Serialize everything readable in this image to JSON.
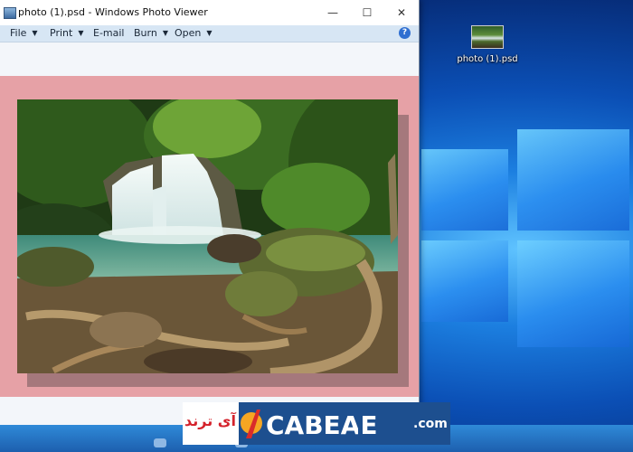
{
  "window": {
    "title": "photo (1).psd - Windows Photo Viewer",
    "controls": {
      "minimize": "—",
      "maximize": "☐",
      "close": "✕"
    }
  },
  "menu": [
    {
      "label": "File",
      "has_dropdown": true
    },
    {
      "label": "Print",
      "has_dropdown": true
    },
    {
      "label": "E-mail",
      "has_dropdown": false
    },
    {
      "label": "Burn",
      "has_dropdown": true
    },
    {
      "label": "Open",
      "has_dropdown": true
    }
  ],
  "help_label": "?",
  "photo": {
    "subject": "waterfall in jungle with mossy rocks and tree roots"
  },
  "desktop_icon": {
    "label": "photo (1).psd",
    "icon": "psd-thumbnail-icon"
  },
  "watermark": {
    "persian_text": "آی ترند",
    "latin_text": "CABEAE",
    "suffix": ".com"
  },
  "colors": {
    "viewer_background": "#e6a1a6",
    "menubar": "#d7e6f4",
    "taskbar": "#1d5fae"
  }
}
